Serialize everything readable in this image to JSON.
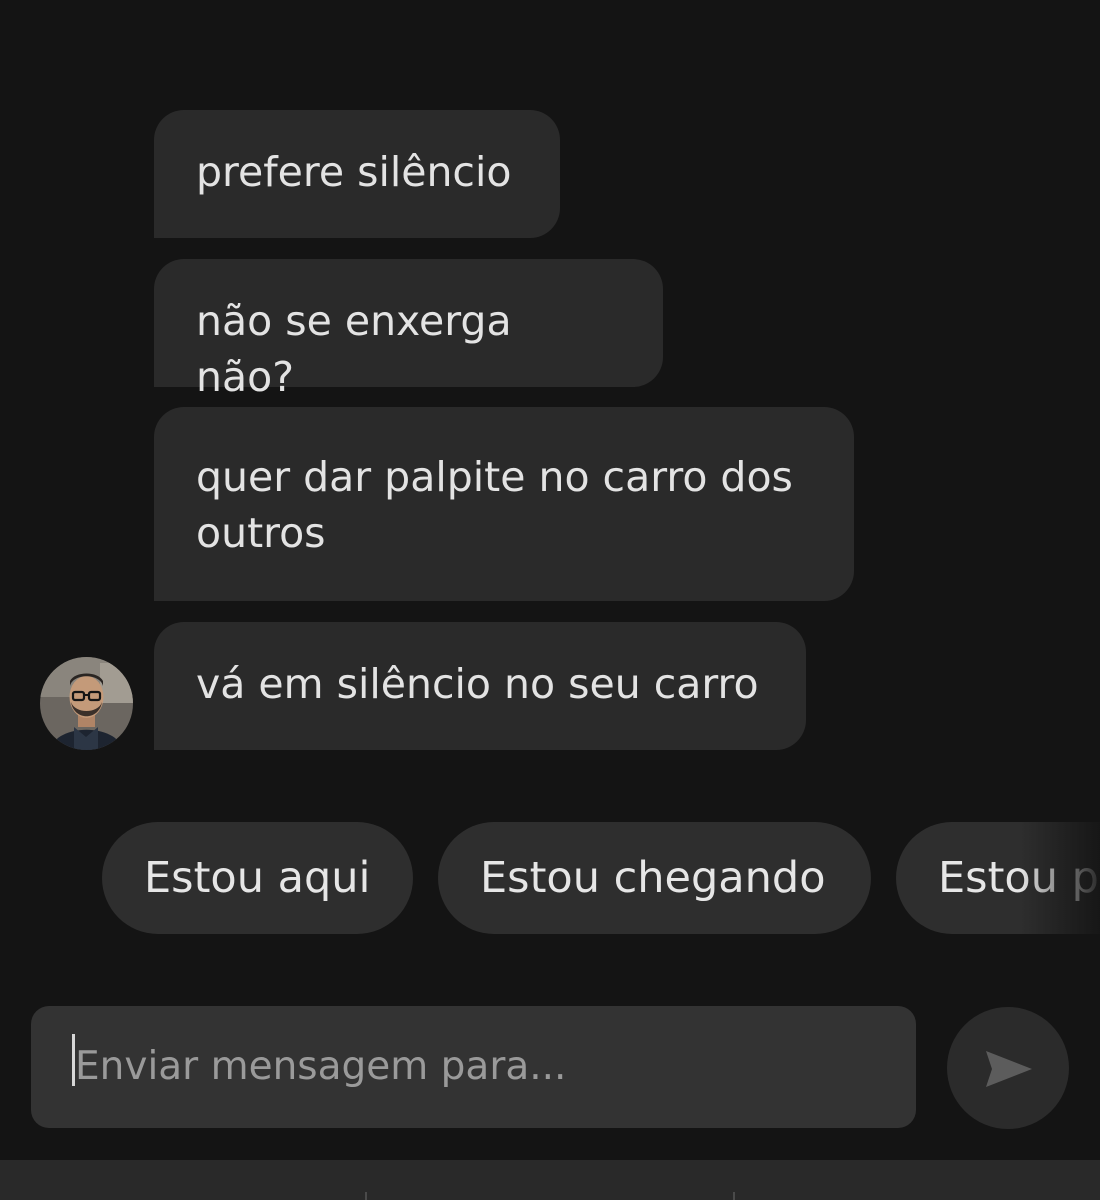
{
  "messages": [
    {
      "text": "prefere silêncio"
    },
    {
      "text": "não se enxerga não?"
    },
    {
      "text": "quer dar palpite no carro dos outros"
    },
    {
      "text": "vá em silêncio no seu carro"
    }
  ],
  "quick_replies": [
    {
      "label": "Estou aqui"
    },
    {
      "label": "Estou chegando"
    },
    {
      "label": "Estou p"
    }
  ],
  "composer": {
    "placeholder": "Enviar mensagem para...",
    "send_icon": "send-arrow-icon"
  },
  "colors": {
    "background": "#141414",
    "bubble": "#2a2a2a",
    "chip": "#2e2e2e",
    "input": "#333333",
    "send_button": "#2b2b2b",
    "send_arrow": "#5c5c5c"
  }
}
